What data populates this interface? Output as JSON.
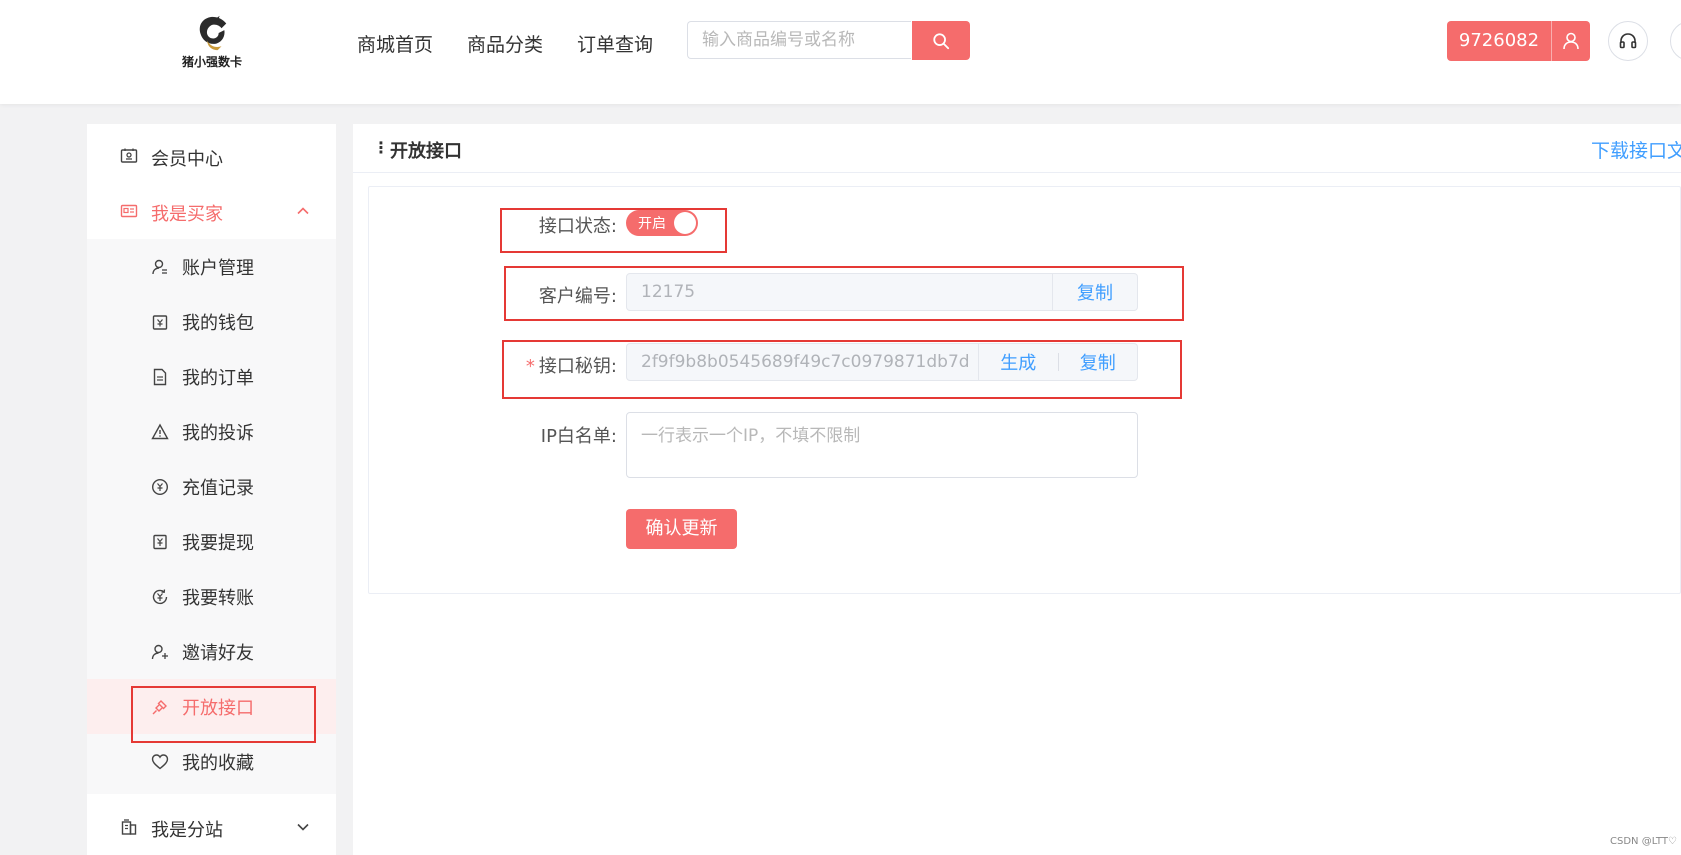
{
  "header": {
    "logo_text": "猪小强数卡",
    "nav": [
      "商城首页",
      "商品分类",
      "订单查询"
    ],
    "search_placeholder": "输入商品编号或名称",
    "user_id": "9726082"
  },
  "sidebar": {
    "member_center": "会员中心",
    "buyer": "我是买家",
    "buyer_items": [
      "账户管理",
      "我的钱包",
      "我的订单",
      "我的投诉",
      "充值记录",
      "我要提现",
      "我要转账",
      "邀请好友",
      "开放接口",
      "我的收藏"
    ],
    "active_item": "开放接口",
    "substation": "我是分站"
  },
  "content": {
    "title": "开放接口",
    "download_link": "下载接口文档",
    "form": {
      "status_label": "接口状态:",
      "status_switch_text": "开启",
      "status_on": true,
      "customer_no_label": "客户编号:",
      "customer_no_value": "12175",
      "copy_label": "复制",
      "secret_label": "接口秘钥:",
      "secret_value": "2f9f9b8b0545689f49c7c0979871db7d",
      "generate_label": "生成",
      "ip_label": "IP白名单:",
      "ip_placeholder": "一行表示一个IP，不填不限制",
      "submit_label": "确认更新"
    }
  },
  "watermark": "CSDN @LTT♡",
  "colors": {
    "accent": "#f56c6c",
    "link": "#409eff",
    "highlight_box": "#e53935"
  }
}
